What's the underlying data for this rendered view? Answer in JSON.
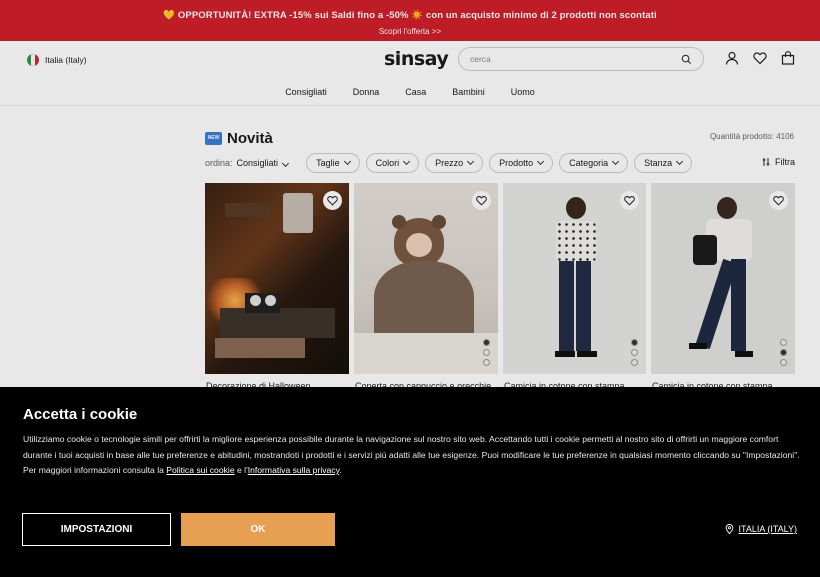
{
  "promo": {
    "line1": "💛 OPPORTUNITÀ! EXTRA -15% sui Saldi fino a -50% ☀️ con un acquisto minimo di 2 prodotti non scontati",
    "line2": "Scopri l'offerta >>",
    "bg_color": "#d11f2a"
  },
  "header": {
    "country": "Italia (Italy)",
    "logo": "sinsay",
    "search_placeholder": "cerca",
    "nav": [
      "Consigliati",
      "Donna",
      "Casa",
      "Bambini",
      "Uomo"
    ]
  },
  "listing": {
    "badge": "NEW",
    "title": "Novità",
    "count": "Quantità prodotto: 4106",
    "sort_label": "ordina:",
    "sort_value": "Consigliati",
    "filters": [
      "Taglie",
      "Colori",
      "Prezzo",
      "Prodotto",
      "Categoria",
      "Stanza"
    ],
    "filter_button": "Filtra"
  },
  "products": [
    {
      "name": "Decorazione di Halloween"
    },
    {
      "name": "Coperta con cappuccio e orecchie"
    },
    {
      "name": "Camicia in cotone con stampa"
    },
    {
      "name": "Camicia in cotone con stampa"
    }
  ],
  "cookie": {
    "title": "Accetta i cookie",
    "text_1": "Utilizziamo cookie o tecnologie simili per offrirti la migliore esperienza possibile durante la navigazione sul nostro sito web. Accettando tutti i cookie permetti al nostro sito di offrirti un maggiore comfort durante i tuoi acquisti in base alle tue preferenze e abitudini, mostrandoti i prodotti e i servizi più adatti alle tue esigenze. Puoi modificare le tue preferenze in qualsiasi momento cliccando su \"Impostazioni\". Per maggiori informazioni consulta la ",
    "link_cookie": "Politica sui cookie",
    "text_2": " e l'",
    "link_privacy": "Informativa sulla privacy",
    "text_3": ".",
    "settings_button": "IMPOSTAZIONI",
    "ok_button": "OK",
    "region": "ITALIA (ITALY)",
    "ok_color": "#e79f52"
  }
}
